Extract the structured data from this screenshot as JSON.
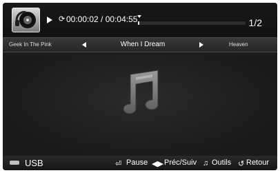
{
  "player": {
    "repeat_icon": "repeat-icon",
    "elapsed": "00:00:02",
    "separator": " / ",
    "duration": "00:04:55",
    "progress_fraction": 0.007,
    "page": "1/2"
  },
  "nav": {
    "prev_title": "Geek In The Pink",
    "current_title": "When I Dream",
    "next_title": "Heaven"
  },
  "footer": {
    "source": "USB",
    "pause_label": "Pause",
    "prevnext_label": "Préc/Suiv",
    "tools_label": "Outils",
    "return_label": "Retour"
  }
}
